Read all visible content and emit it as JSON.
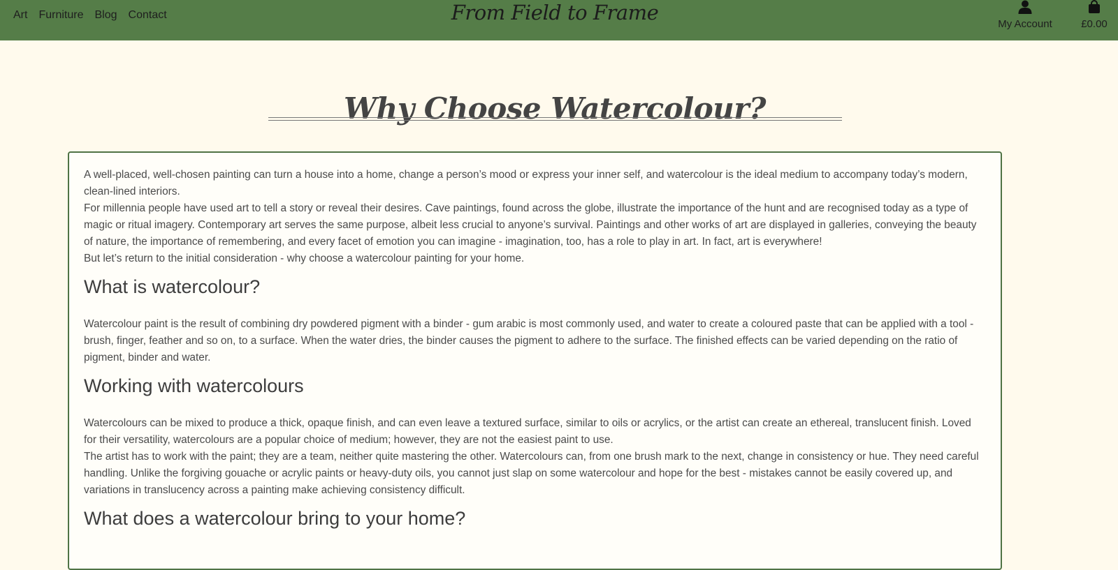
{
  "nav": {
    "items": [
      "Art",
      "Furniture",
      "Blog",
      "Contact"
    ]
  },
  "brand": {
    "title": "From Field to Frame"
  },
  "account": {
    "label": "My Account",
    "icon": "user-icon"
  },
  "cart": {
    "total": "£0.00",
    "icon": "shopping-bag-icon"
  },
  "colors": {
    "header": "#557d48",
    "background": "#fffaed",
    "card_border": "#4f7345"
  },
  "page": {
    "title": "Why Choose Watercolour?"
  },
  "article": {
    "intro": [
      "A well-placed, well-chosen painting can turn a house into a home, change a person’s mood or express your inner self, and watercolour is the ideal medium to accompany today’s modern, clean-lined interiors.",
      "For millennia people have used art to tell a story or reveal their desires. Cave paintings, found across the globe, illustrate the importance of the hunt and are recognised today as a type of magic or ritual imagery. Contemporary art serves the same purpose, albeit less crucial to anyone’s survival. Paintings and other works of art are displayed in galleries, conveying the beauty of nature, the importance of remembering, and every facet of emotion you can imagine - imagination, too, has a role to play in art. In fact, art is everywhere!",
      "But let’s return to the initial consideration - why choose a watercolour painting for your home."
    ],
    "sections": [
      {
        "heading": "What is watercolour?",
        "paragraphs": [
          "Watercolour paint is the result of combining dry powdered pigment with a binder - gum arabic is most commonly used, and water to create a coloured paste that can be applied with a tool - brush, finger, feather and so on, to a surface. When the water dries, the binder causes the pigment to adhere to the surface. The finished effects can be varied depending on the ratio of pigment, binder and water."
        ]
      },
      {
        "heading": "Working with watercolours",
        "paragraphs": [
          "Watercolours can be mixed to produce a thick, opaque finish, and can even leave a textured surface, similar to oils or acrylics, or the artist can create an ethereal, translucent finish. Loved for their versatility, watercolours are a popular choice of medium; however, they are not the easiest paint to use.",
          "The artist has to work with the paint; they are a team, neither quite mastering the other. Watercolours can, from one brush mark to the next, change in consistency or hue. They need careful handling. Unlike the forgiving gouache or acrylic paints or heavy-duty oils, you cannot just slap on some watercolour and hope for the best - mistakes cannot be easily covered up, and variations in translucency across a painting make achieving consistency difficult."
        ]
      },
      {
        "heading": "What does a watercolour bring to your home?",
        "paragraphs": []
      }
    ]
  }
}
